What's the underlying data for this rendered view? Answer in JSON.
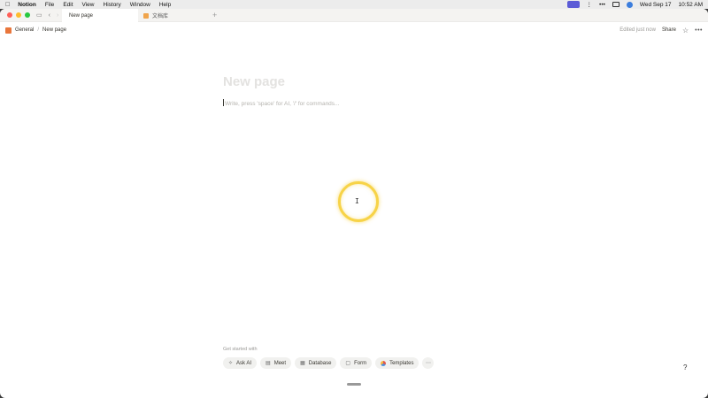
{
  "menubar": {
    "app_name": "Notion",
    "menus": [
      "File",
      "Edit",
      "View",
      "History",
      "Window",
      "Help"
    ],
    "date": "Wed Sep 17",
    "time": "10:52 AM"
  },
  "tabs": [
    {
      "label": "New page"
    },
    {
      "label": "文档库"
    }
  ],
  "breadcrumb": {
    "workspace": "General",
    "page": "New page"
  },
  "topbar": {
    "edited": "Edited just now",
    "share": "Share"
  },
  "page": {
    "title_placeholder": "New page",
    "body_placeholder": "Write, press 'space' for AI, '/' for commands..."
  },
  "get_started": {
    "label": "Get started with",
    "items": [
      {
        "label": "Ask AI",
        "icon": "sparkle-icon"
      },
      {
        "label": "Meet",
        "icon": "meet-icon"
      },
      {
        "label": "Database",
        "icon": "table-icon"
      },
      {
        "label": "Form",
        "icon": "form-icon"
      },
      {
        "label": "Templates",
        "icon": "templates-icon"
      }
    ]
  },
  "colors": {
    "accent_cursor": "#f7d348",
    "breadcrumb_icon": "#e9763b"
  }
}
